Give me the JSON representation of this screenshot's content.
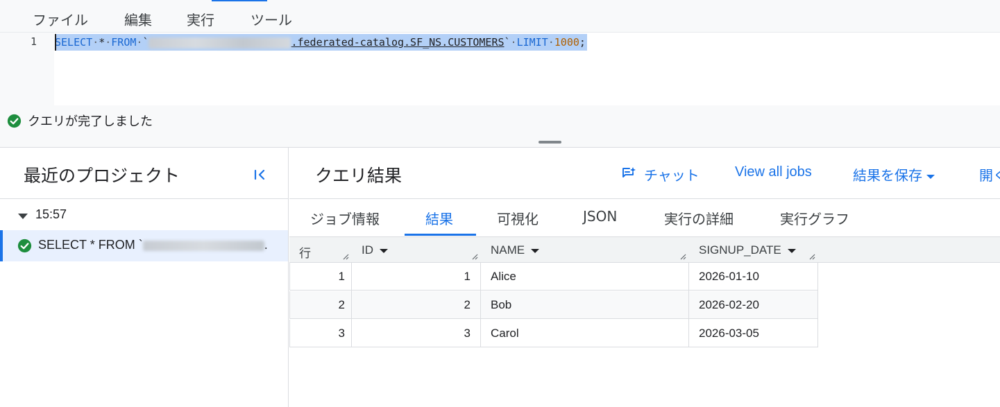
{
  "menu": {
    "items": [
      "ファイル",
      "編集",
      "実行",
      "ツール"
    ]
  },
  "editor": {
    "line_number": "1",
    "code": {
      "select": "SELECT",
      "star": "*",
      "from": "FROM",
      "backtick_open": "`",
      "table_path": ".federated-catalog.SF_NS.CUSTOMERS",
      "backtick_close": "`",
      "limit": "LIMIT",
      "limit_value": "1000",
      "semicolon": ";"
    }
  },
  "status": {
    "icon": "check-circle-icon",
    "text": "クエリが完了しました",
    "color": "#1e8e3e"
  },
  "recent": {
    "title": "最近のプロジェクト",
    "collapse_icon": "collapse-left-icon",
    "group_label": "15:57",
    "job_text": "SELECT * FROM `",
    "job_ellipsis": "."
  },
  "results": {
    "title": "クエリ結果",
    "actions": {
      "chat": "チャット",
      "view_jobs": "View all jobs",
      "save_results": "結果を保存",
      "open": "開く"
    },
    "tabs": [
      "ジョブ情報",
      "結果",
      "可視化",
      "JSON",
      "実行の詳細",
      "実行グラフ"
    ],
    "active_tab": "結果",
    "columns": [
      "行",
      "ID",
      "NAME",
      "SIGNUP_DATE"
    ],
    "rows": [
      {
        "row": "1",
        "id": "1",
        "name": "Alice",
        "signup_date": "2026-01-10"
      },
      {
        "row": "2",
        "id": "2",
        "name": "Bob",
        "signup_date": "2026-02-20"
      },
      {
        "row": "3",
        "id": "3",
        "name": "Carol",
        "signup_date": "2026-03-05"
      }
    ]
  },
  "colors": {
    "accent": "#1a73e8",
    "selection": "#b3d0f7",
    "keyword": "#1967d2",
    "number": "#b06000"
  }
}
